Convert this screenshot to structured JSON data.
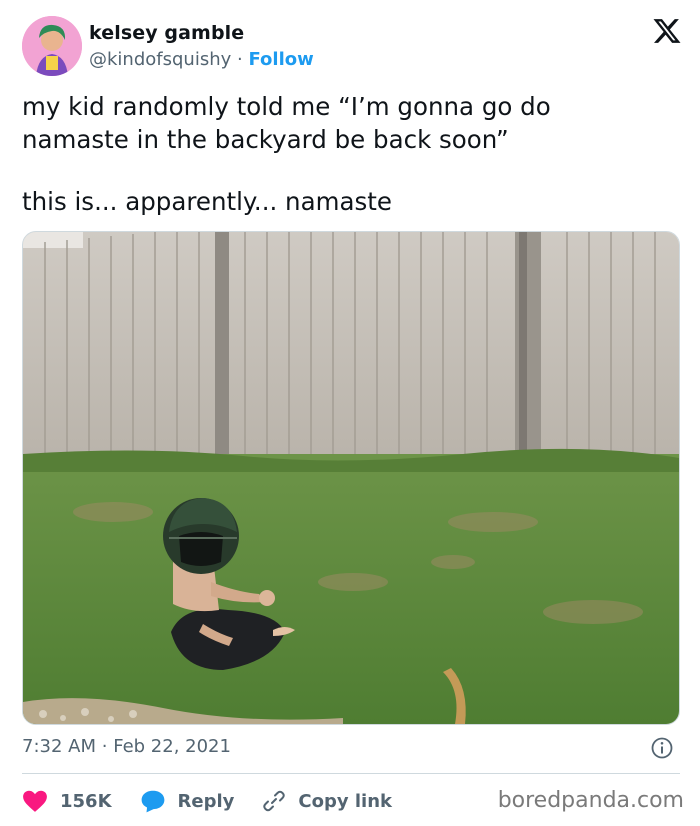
{
  "author": {
    "name": "kelsey gamble",
    "handle": "@kindofsquishy",
    "separator": "·",
    "follow_label": "Follow"
  },
  "tweet": {
    "line1": "my kid randomly told me “I’m gonna go do namaste in the backyard be back soon”",
    "line2": "this is... apparently... namaste",
    "time": "7:32 AM",
    "date_sep": "·",
    "date": "Feb 22, 2021"
  },
  "actions": {
    "likes": "156K",
    "reply_label": "Reply",
    "copy_label": "Copy link"
  },
  "watermark": "boredpanda.com",
  "colors": {
    "accent": "#1d9bf0",
    "heart": "#f91880",
    "muted": "#536471"
  }
}
